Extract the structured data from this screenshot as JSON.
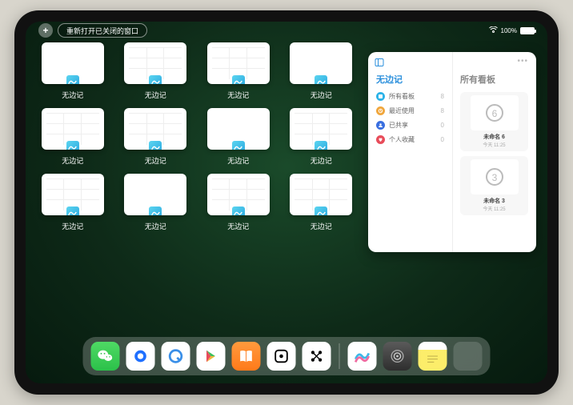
{
  "status": {
    "reopen_label": "重新打开已关闭的窗口",
    "battery_pct": "100%"
  },
  "app_name": "无边记",
  "windows": [
    {
      "label": "无边记",
      "variant": "blank"
    },
    {
      "label": "无边记",
      "variant": "grid"
    },
    {
      "label": "无边记",
      "variant": "grid"
    },
    {
      "label": "无边记",
      "variant": "blank"
    },
    {
      "label": "无边记",
      "variant": "grid"
    },
    {
      "label": "无边记",
      "variant": "grid"
    },
    {
      "label": "无边记",
      "variant": "blank"
    },
    {
      "label": "无边记",
      "variant": "grid"
    },
    {
      "label": "无边记",
      "variant": "grid"
    },
    {
      "label": "无边记",
      "variant": "blank"
    },
    {
      "label": "无边记",
      "variant": "grid"
    },
    {
      "label": "无边记",
      "variant": "grid"
    }
  ],
  "panel": {
    "left_title": "无边记",
    "right_title": "所有看板",
    "categories": [
      {
        "label": "所有看板",
        "count": "8",
        "color": "#2cb3e8"
      },
      {
        "label": "最近使用",
        "count": "8",
        "color": "#f0a63c"
      },
      {
        "label": "已共享",
        "count": "0",
        "color": "#3a6fe0"
      },
      {
        "label": "个人收藏",
        "count": "0",
        "color": "#e84c5a"
      }
    ],
    "boards": [
      {
        "name": "未命名 6",
        "date": "今天 11:25",
        "glyph": "6"
      },
      {
        "name": "未命名 3",
        "date": "今天 11:25",
        "glyph": "3"
      }
    ]
  },
  "dock": {
    "items": [
      "wechat",
      "qq",
      "quark",
      "play",
      "books",
      "dice",
      "dots",
      "freeform",
      "settings",
      "notes",
      "folder"
    ]
  }
}
